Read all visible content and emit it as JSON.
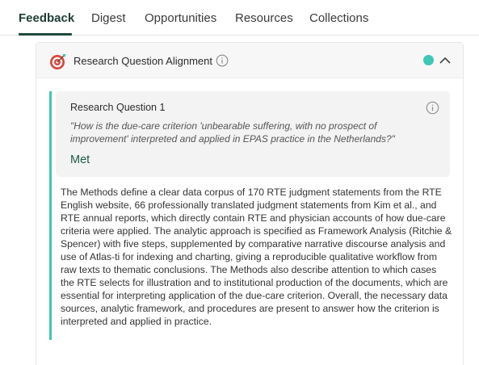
{
  "tabs": [
    {
      "label": "Feedback",
      "active": true
    },
    {
      "label": "Digest",
      "active": false
    },
    {
      "label": "Opportunities",
      "active": false
    },
    {
      "label": "Resources",
      "active": false
    },
    {
      "label": "Collections",
      "active": false
    }
  ],
  "panel": {
    "title": "Research Question Alignment",
    "icon": "target-icon",
    "status_color": "#3ec7b4"
  },
  "research_question": {
    "title": "Research Question 1",
    "quote": "\"How is the due-care criterion 'unbearable suffering, with no prospect of improvement' interpreted and applied in EPAS practice in the Netherlands?\"",
    "status": "Met"
  },
  "body": "The Methods define a clear data corpus of 170 RTE judgment statements from the RTE English website, 66 professionally translated judgment statements from Kim et al., and RTE annual reports, which directly contain RTE and physician accounts of how due-care criteria were applied. The analytic approach is specified as Framework Analysis (Ritchie & Spencer) with five steps, supplemented by comparative narrative discourse analysis and use of Atlas-ti for indexing and charting, giving a reproducible qualitative workflow from raw texts to thematic conclusions. The Methods also describe attention to which cases the RTE selects for illustration and to institutional production of the documents, which are essential for interpreting application of the due-care criterion. Overall, the necessary data sources, analytic framework, and procedures are present to answer how the criterion is interpreted and applied in practice.",
  "colors": {
    "accent": "#3ec7b4",
    "active_tab": "#1f4a3e",
    "met_text": "#1f5a48"
  }
}
